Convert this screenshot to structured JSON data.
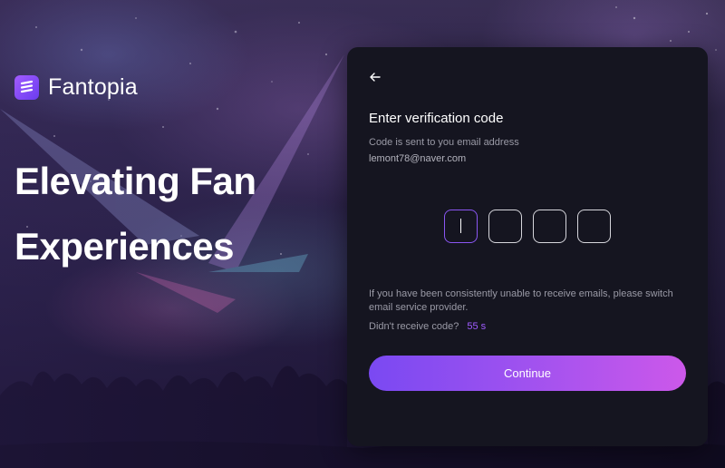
{
  "brand": {
    "name": "Fantopia",
    "logo_icon": "brand-logo-icon"
  },
  "hero": {
    "line1": "Elevating Fan",
    "line2": "Experiences"
  },
  "verify": {
    "back_icon": "arrow-left-icon",
    "title": "Enter verification code",
    "subtitle": "Code is sent to you email address",
    "email": "lemont78@naver.com",
    "code_digits": [
      "",
      "",
      "",
      ""
    ],
    "help_text": "If you have been consistently unable to receive emails, please switch email service provider.",
    "resend_label": "Didn't receive code?",
    "resend_timer": "55 s",
    "continue_label": "Continue"
  },
  "colors": {
    "accent": "#a05cff",
    "button_gradient_start": "#7a49f2",
    "button_gradient_end": "#cc58ea",
    "card_bg": "#151520"
  }
}
